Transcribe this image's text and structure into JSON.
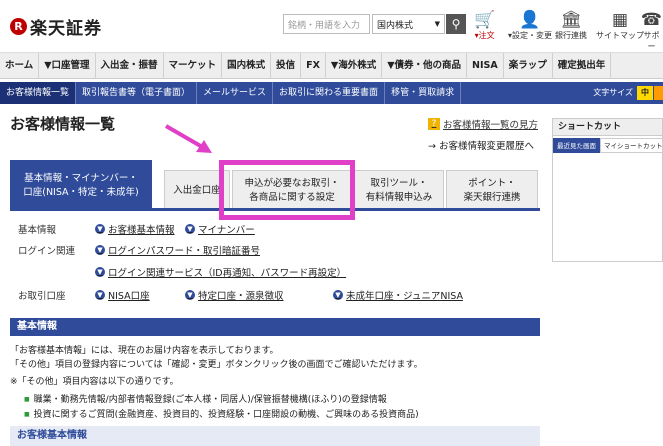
{
  "header": {
    "logo_mark": "R",
    "logo_text": "楽天証券",
    "search_placeholder": "銘柄・用語を入力",
    "search_scope": "国内株式",
    "icons": [
      {
        "name": "cart-icon",
        "glyph": "🛒",
        "label": "▾注文"
      },
      {
        "name": "user-icon",
        "glyph": "👤",
        "label": "▾設定・変更"
      },
      {
        "name": "bank-icon",
        "glyph": "🏛",
        "label": "銀行連携"
      },
      {
        "name": "sitemap-icon",
        "glyph": "▦",
        "label": "サイトマップ"
      },
      {
        "name": "support-icon",
        "glyph": "☎",
        "label": "サポー"
      }
    ]
  },
  "mainnav": [
    "ホーム",
    "▼口座管理",
    "入出金・振替",
    "マーケット",
    "国内株式",
    "投信",
    "FX",
    "▼海外株式",
    "▼債券・他の商品",
    "NISA",
    "楽ラップ",
    "確定拠出年"
  ],
  "subnav": {
    "items": [
      "お客様情報一覧",
      "取引報告書等（電子書面）",
      "メールサービス",
      "お取引に関わる重要書面",
      "移管・買取請求"
    ],
    "font_size_label": "文字サイズ",
    "font_size_mid": "中"
  },
  "page": {
    "title": "お客様情報一覧",
    "help_link": "お客様情報一覧の見方",
    "history_link": "→ お客様情報変更履歴へ"
  },
  "tabs": [
    {
      "line1": "基本情報・マイナンバー・",
      "line2": "口座(NISA・特定・未成年)"
    },
    {
      "line1": "入出金口座",
      "line2": ""
    },
    {
      "line1": "申込が必要なお取引・",
      "line2": "各商品に関する設定"
    },
    {
      "line1": "取引ツール・",
      "line2": "有料情報申込み"
    },
    {
      "line1": "ポイント・",
      "line2": "楽天銀行連携"
    }
  ],
  "links": {
    "basic_label": "基本情報",
    "basic_links": [
      "お客様基本情報",
      "マイナンバー"
    ],
    "login_label": "ログイン関連",
    "login_links": [
      "ログインパスワード・取引暗証番号",
      "ログイン関連サービス（ID再通知、パスワード再設定）"
    ],
    "account_label": "お取引口座",
    "account_links": [
      "NISA口座",
      "特定口座・源泉徴収",
      "未成年口座・ジュニアNISA"
    ]
  },
  "basic_section": {
    "heading": "基本情報",
    "lines": [
      "「お客様基本情報」には、現在のお届け内容を表示しております。",
      "「その他」項目の登録内容については「確認・変更」ボタンクリック後の画面でご確認いただけます。",
      "※「その他」項目内容は以下の通りです。"
    ],
    "bullets": [
      "職業・勤務先情報/内部者情報登録(ご本人様・同居人)/保管振替機構(ほふり)の登録情報",
      "投資に関するご質問(金融資産、投資目的、投資経験・口座開設の動機、ご興味のある投資商品)"
    ],
    "subheading": "お客様基本情報"
  },
  "shortcut": {
    "title": "ショートカット",
    "tabs": [
      "最近見た画面",
      "マイショートカット"
    ]
  }
}
